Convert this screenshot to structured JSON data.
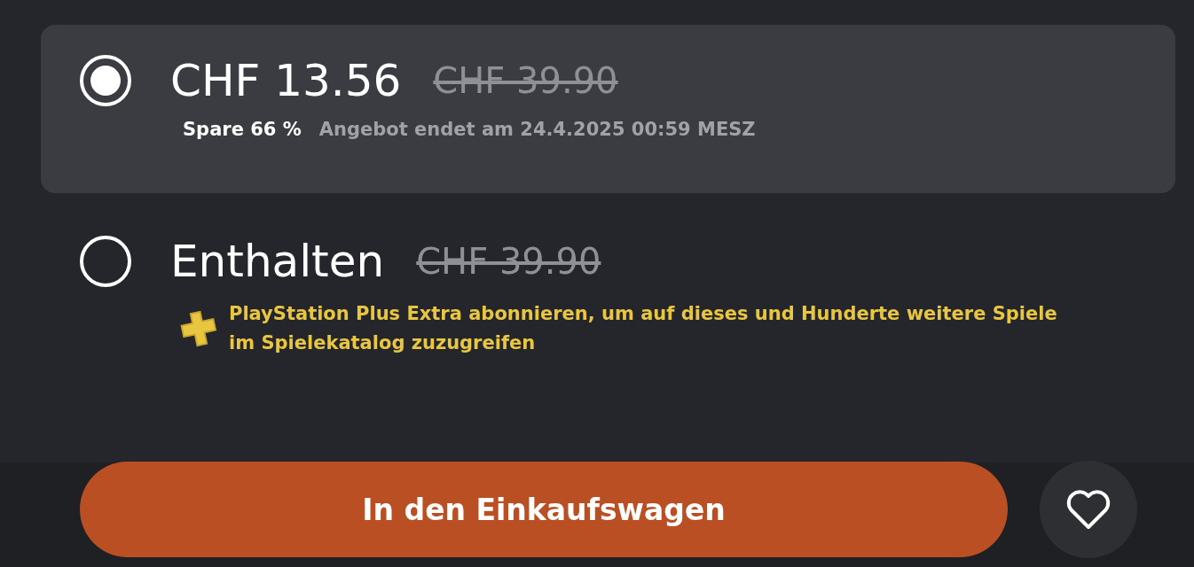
{
  "offers": [
    {
      "kind": "discount",
      "selected": true,
      "price": "CHF 13.56",
      "original_price": "CHF 39.90",
      "saving": "Spare 66 %",
      "ends": "Angebot endet am 24.4.2025 00:59 MESZ"
    },
    {
      "kind": "plus",
      "selected": false,
      "price": "Enthalten",
      "original_price": "CHF 39.90",
      "note": "PlayStation Plus Extra abonnieren, um auf dieses und Hunderte weitere Spiele im Spielekatalog zuzugreifen"
    }
  ],
  "cart_button": "In den Einkaufswagen"
}
